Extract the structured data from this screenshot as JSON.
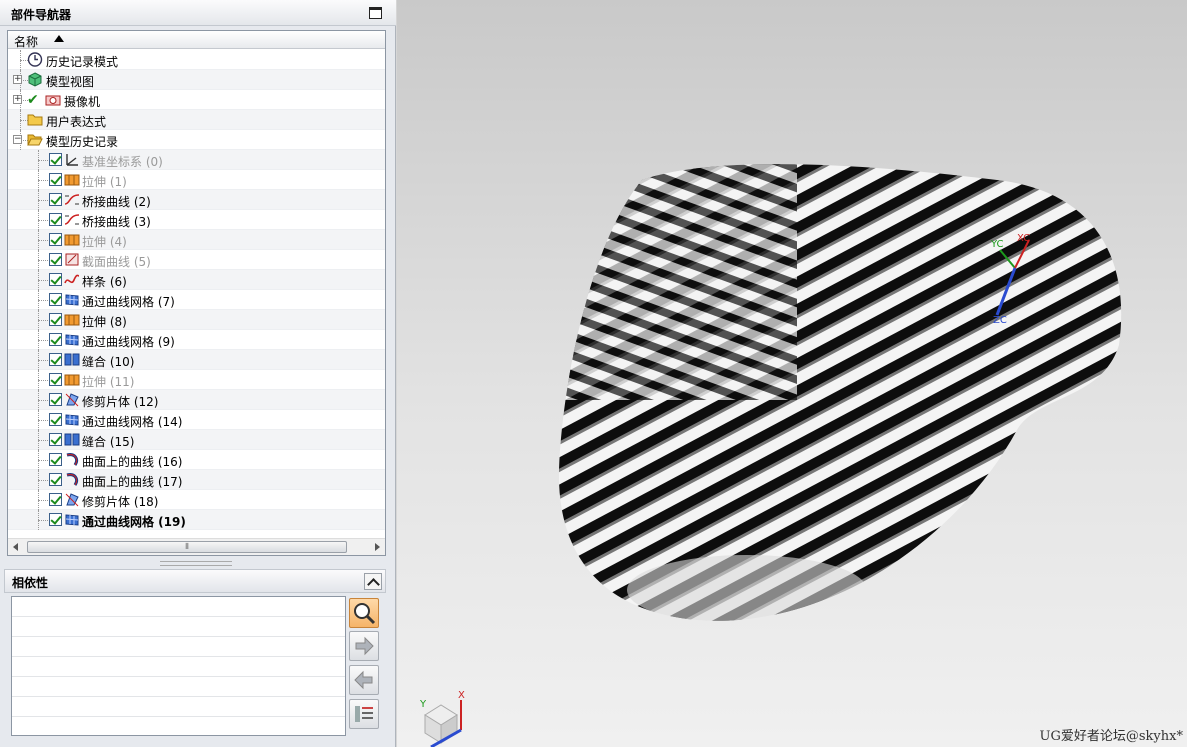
{
  "navigator": {
    "title": "部件导航器",
    "column_name": "名称",
    "rows": [
      {
        "label": "历史记录模式",
        "icon": "clock-icon",
        "state": "normal",
        "level": 0,
        "expander": "none"
      },
      {
        "label": "模型视图",
        "icon": "model-view-cube-icon",
        "state": "normal",
        "level": 0,
        "expander": "plus"
      },
      {
        "label": "摄像机",
        "icon": "camera-icon",
        "state": "normal",
        "level": 0,
        "expander": "plus",
        "checkmark": true
      },
      {
        "label": "用户表达式",
        "icon": "folder-icon",
        "state": "normal",
        "level": 0,
        "expander": "none"
      },
      {
        "label": "模型历史记录",
        "icon": "folder-open-icon",
        "state": "normal",
        "level": 0,
        "expander": "minus"
      },
      {
        "label": "基准坐标系 (0)",
        "icon": "datum-csys-icon",
        "state": "gray",
        "level": 1
      },
      {
        "label": "拉伸 (1)",
        "icon": "extrude-icon",
        "state": "gray",
        "level": 1
      },
      {
        "label": "桥接曲线 (2)",
        "icon": "bridge-curve-icon",
        "state": "normal",
        "level": 1
      },
      {
        "label": "桥接曲线 (3)",
        "icon": "bridge-curve-icon",
        "state": "normal",
        "level": 1
      },
      {
        "label": "拉伸 (4)",
        "icon": "extrude-icon",
        "state": "gray",
        "level": 1
      },
      {
        "label": "截面曲线 (5)",
        "icon": "section-curve-icon",
        "state": "gray",
        "level": 1
      },
      {
        "label": "样条 (6)",
        "icon": "spline-icon",
        "state": "normal",
        "level": 1
      },
      {
        "label": "通过曲线网格 (7)",
        "icon": "curve-mesh-icon",
        "state": "normal",
        "level": 1
      },
      {
        "label": "拉伸 (8)",
        "icon": "extrude-icon",
        "state": "normal",
        "level": 1
      },
      {
        "label": "通过曲线网格 (9)",
        "icon": "curve-mesh-icon",
        "state": "normal",
        "level": 1
      },
      {
        "label": "缝合 (10)",
        "icon": "sew-icon",
        "state": "normal",
        "level": 1
      },
      {
        "label": "拉伸 (11)",
        "icon": "extrude-icon",
        "state": "gray",
        "level": 1
      },
      {
        "label": "修剪片体 (12)",
        "icon": "trim-sheet-icon",
        "state": "normal",
        "level": 1
      },
      {
        "label": "通过曲线网格 (14)",
        "icon": "curve-mesh-icon",
        "state": "normal",
        "level": 1
      },
      {
        "label": "缝合 (15)",
        "icon": "sew-icon",
        "state": "normal",
        "level": 1
      },
      {
        "label": "曲面上的曲线 (16)",
        "icon": "curve-on-surface-icon",
        "state": "normal",
        "level": 1
      },
      {
        "label": "曲面上的曲线 (17)",
        "icon": "curve-on-surface-icon",
        "state": "normal",
        "level": 1
      },
      {
        "label": "修剪片体 (18)",
        "icon": "trim-sheet-icon",
        "state": "normal",
        "level": 1
      },
      {
        "label": "通过曲线网格 (19)",
        "icon": "curve-mesh-icon",
        "state": "bold",
        "level": 1
      }
    ]
  },
  "dependencies": {
    "title": "相依性",
    "buttons": [
      "magnifier-icon",
      "arrow-right-icon",
      "arrow-left-icon",
      "list-details-icon"
    ]
  },
  "viewport": {
    "watermark": "UG爱好者论坛@skyhx*",
    "wcs_labels": {
      "xc": "XC",
      "yc": "YC",
      "zc": "ZC"
    },
    "triad_labels": {
      "x": "X",
      "y": "Y"
    }
  },
  "colors": {
    "accent": "#f5b469",
    "extrude": "#f29a30",
    "mesh": "#3a6fd0",
    "check": "#1c8a1c"
  }
}
